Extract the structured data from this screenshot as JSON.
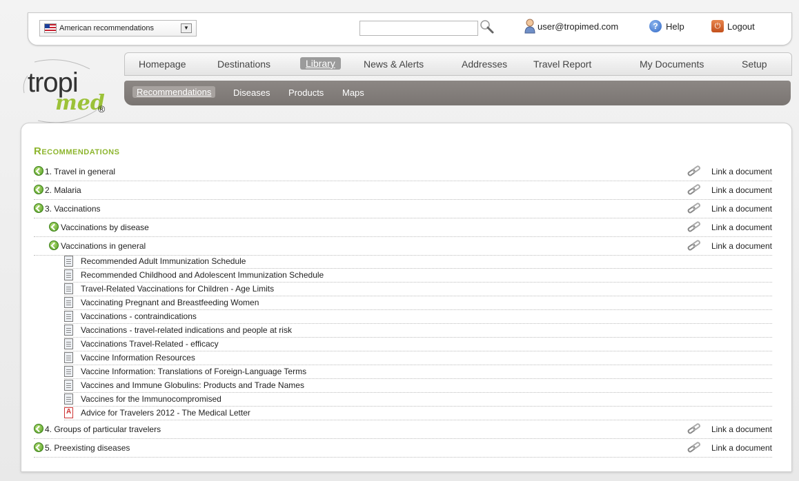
{
  "topbar": {
    "language": "American recommendations",
    "search_value": "",
    "user_email": "user@tropimed.com",
    "help_label": "Help",
    "logout_label": "Logout"
  },
  "logo": {
    "main": "tropi",
    "sub": "med",
    "reg": "®"
  },
  "mainnav": {
    "items": [
      "Homepage",
      "Destinations",
      "Library",
      "News & Alerts",
      "Addresses",
      "Travel Report",
      "My Documents",
      "Setup"
    ],
    "active": "Library"
  },
  "subnav": {
    "items": [
      "Recommendations",
      "Diseases",
      "Products",
      "Maps"
    ],
    "active": "Recommendations"
  },
  "content": {
    "heading": "Recommendations",
    "link_label": "Link a document",
    "sections": [
      "1. Travel in general",
      "2. Malaria",
      "3. Vaccinations",
      "Vaccinations by disease",
      "Vaccinations in general",
      "4. Groups of particular travelers",
      "5. Preexisting diseases"
    ],
    "documents": [
      "Recommended Adult Immunization Schedule",
      "Recommended Childhood and Adolescent Immunization Schedule",
      "Travel-Related Vaccinations for Children - Age Limits",
      "Vaccinating Pregnant and Breastfeeding Women",
      "Vaccinations - contraindications",
      "Vaccinations - travel-related indications and people at risk",
      "Vaccinations Travel-Related - efficacy",
      "Vaccine Information Resources",
      "Vaccine Information: Translations of Foreign-Language Terms",
      "Vaccines and Immune Globulins: Products and Trade Names",
      "Vaccines for the Immunocompromised",
      "Advice for Travelers 2012 - The Medical Letter"
    ]
  }
}
